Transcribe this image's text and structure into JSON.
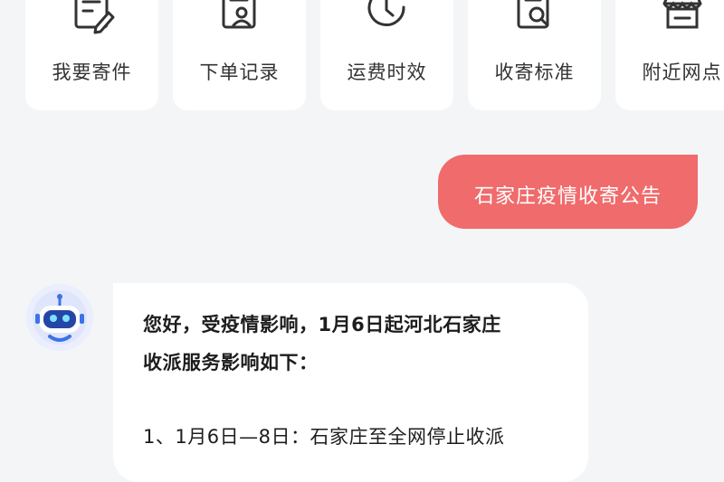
{
  "shortcuts": [
    {
      "label": "我要寄件",
      "icon": "document-edit-icon"
    },
    {
      "label": "下单记录",
      "icon": "order-record-icon"
    },
    {
      "label": "运费时效",
      "icon": "clock-refresh-icon"
    },
    {
      "label": "收寄标准",
      "icon": "document-search-icon"
    },
    {
      "label": "附近网点",
      "icon": "store-icon"
    }
  ],
  "chat": {
    "user_message": "石家庄疫情收寄公告",
    "bot_message": {
      "line1": "您好，受疫情影响，1月6日起河北石家庄",
      "line2": "收派服务影响如下：",
      "line3": "1、1月6日—8日：石家庄至全网停止收派"
    }
  },
  "colors": {
    "background": "#f4f5f7",
    "card": "#ffffff",
    "user_bubble": "#f06b6b",
    "icon_stroke": "#333333"
  }
}
